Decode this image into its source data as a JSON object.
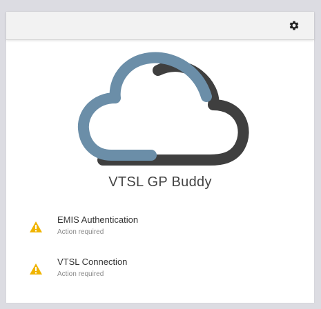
{
  "app": {
    "title": "VTSL GP Buddy"
  },
  "toolbar": {
    "settings_icon": "gear-icon"
  },
  "colors": {
    "cloud_blue": "#6b8ea8",
    "cloud_dark": "#3f3f3f",
    "warning": "#f0b400",
    "background": "#dcdce2"
  },
  "status_items": [
    {
      "title": "EMIS Authentication",
      "status": "Action required",
      "icon": "warning-icon"
    },
    {
      "title": "VTSL Connection",
      "status": "Action required",
      "icon": "warning-icon"
    }
  ]
}
